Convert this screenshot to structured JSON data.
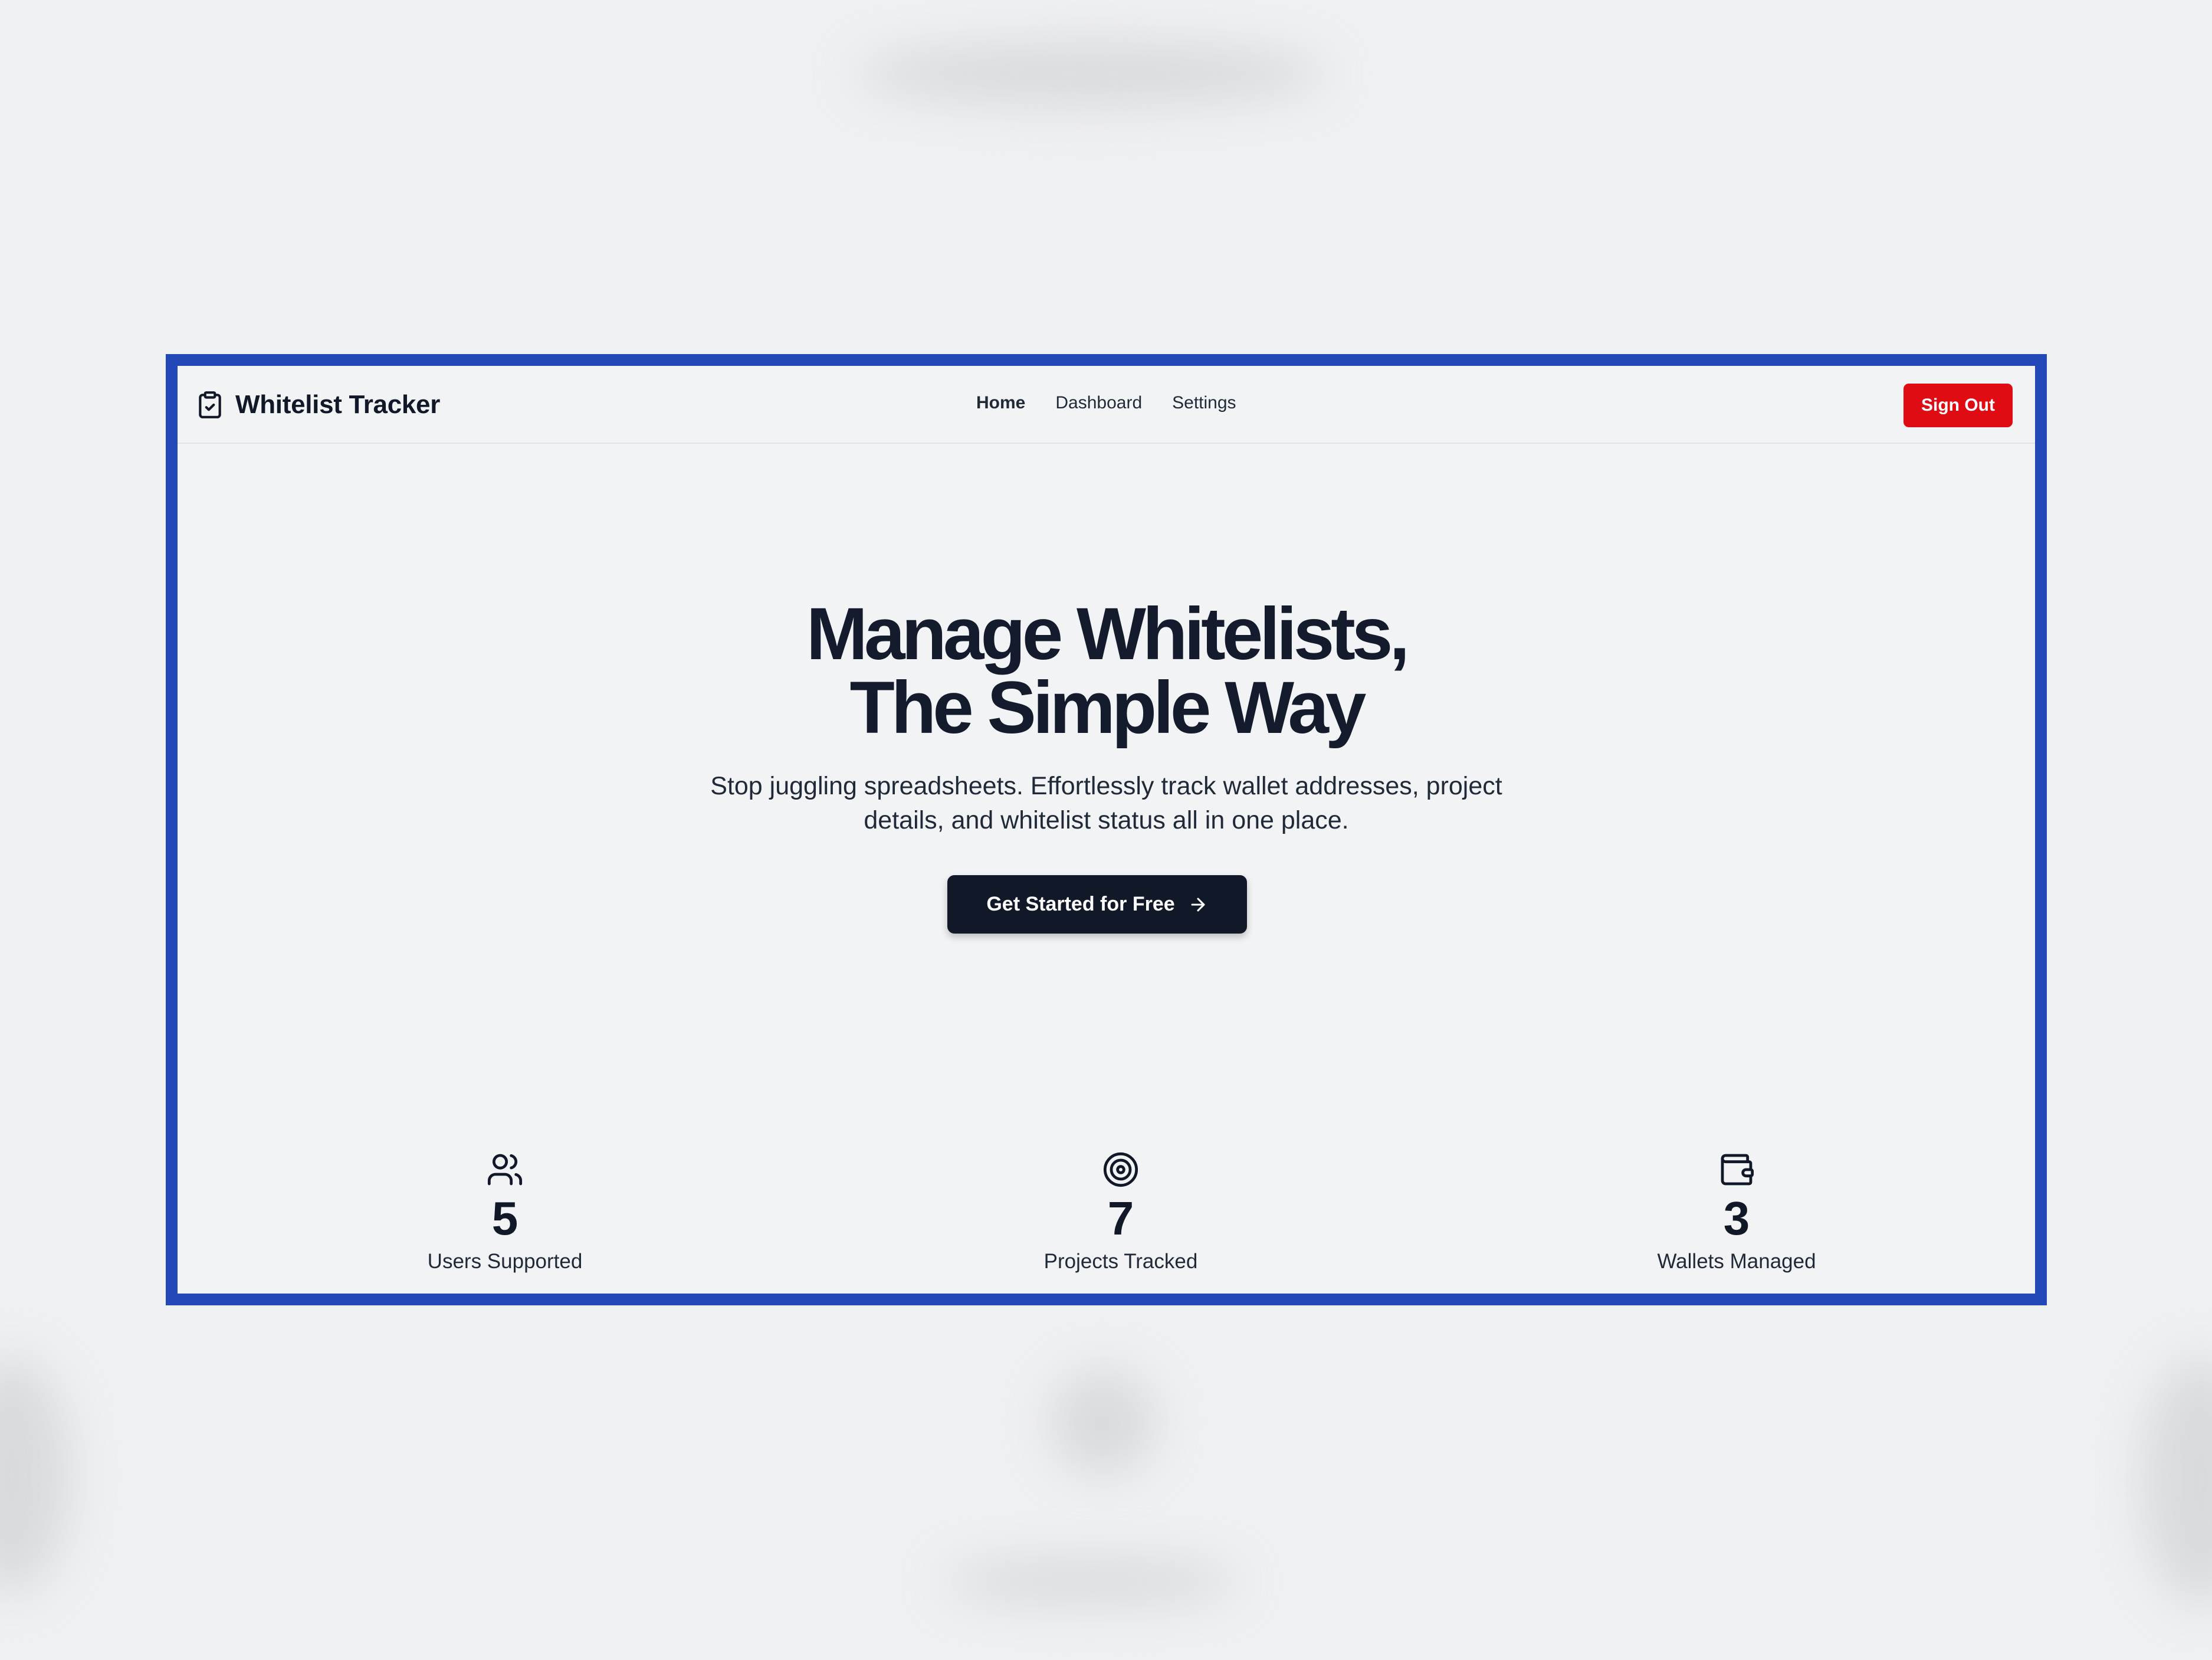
{
  "app": {
    "name": "Whitelist Tracker",
    "logo_icon": "clipboard-check-icon"
  },
  "nav": {
    "links": [
      "Home",
      "Dashboard",
      "Settings"
    ],
    "active": "Home"
  },
  "auth": {
    "signout_label": "Sign Out"
  },
  "hero": {
    "title_line1": "Manage Whitelists,",
    "title_line2": "The Simple Way",
    "subtitle": "Stop juggling spreadsheets. Effortlessly track wallet addresses, project details, and whitelist status all in one place.",
    "cta_label": "Get Started for Free",
    "cta_icon": "arrow-right-icon"
  },
  "stats": [
    {
      "icon": "users-icon",
      "value": "5",
      "label": "Users Supported"
    },
    {
      "icon": "target-icon",
      "value": "7",
      "label": "Projects Tracked"
    },
    {
      "icon": "wallet-icon",
      "value": "3",
      "label": "Wallets Managed"
    }
  ],
  "colors": {
    "frame_border": "#2349b9",
    "signout_bg": "#e00c14",
    "cta_bg": "#111827",
    "text_dark": "#141b2d"
  }
}
